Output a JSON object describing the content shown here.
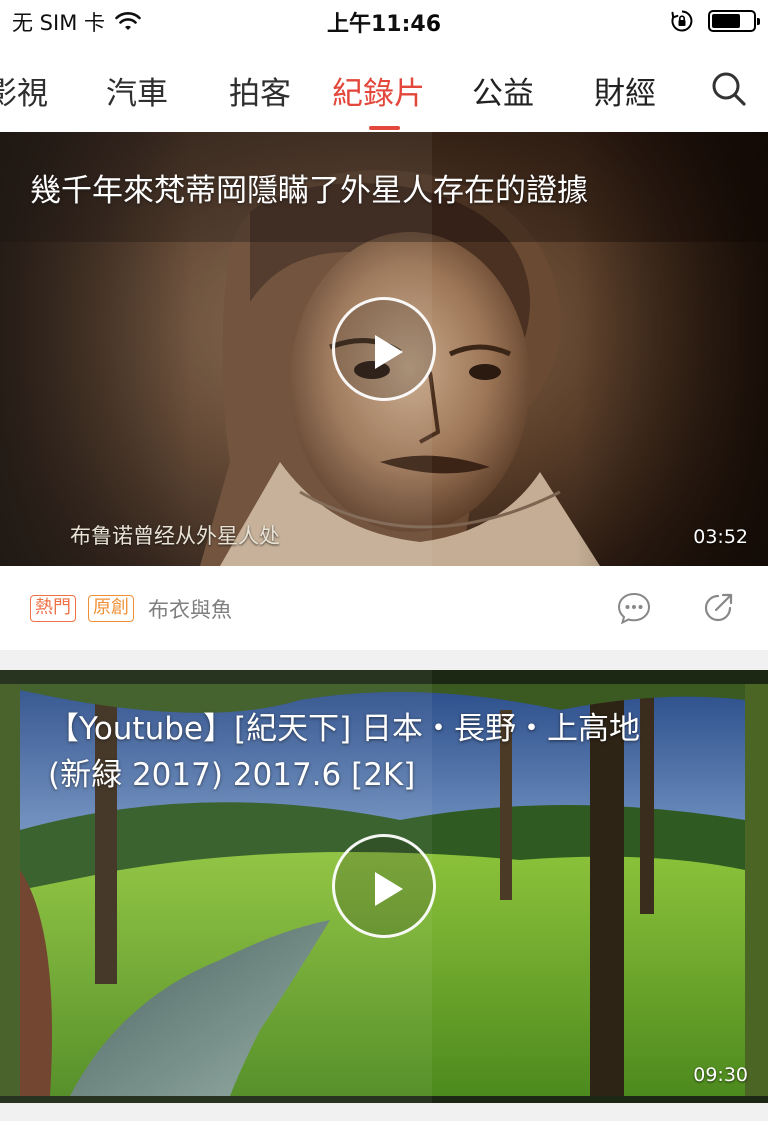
{
  "status_bar": {
    "carrier": "无 SIM 卡",
    "time": "上午11:46",
    "battery_level": 0.7,
    "icons": [
      "wifi-icon",
      "orientation-lock-icon",
      "battery-icon"
    ]
  },
  "nav": {
    "tabs": [
      {
        "label": "影視",
        "active": false
      },
      {
        "label": "汽車",
        "active": false
      },
      {
        "label": "拍客",
        "active": false
      },
      {
        "label": "紀錄片",
        "active": true
      },
      {
        "label": "公益",
        "active": false
      },
      {
        "label": "財經",
        "active": false
      }
    ],
    "search_icon": "search-icon",
    "accent_color": "#e23b2e"
  },
  "videos": [
    {
      "title": "幾千年來梵蒂岡隱瞞了外星人存在的證據",
      "subtitle": "布鲁诺曾经从外星人处",
      "duration": "03:52",
      "badges": [
        "熱門",
        "原創"
      ],
      "author": "布衣與魚",
      "actions": [
        "comment-icon",
        "share-icon"
      ]
    },
    {
      "title_line1": "【Youtube】[紀天下] 日本・長野・上高地",
      "title_line2": "(新緑 2017)  2017.6 [2K]",
      "duration": "09:30"
    }
  ]
}
